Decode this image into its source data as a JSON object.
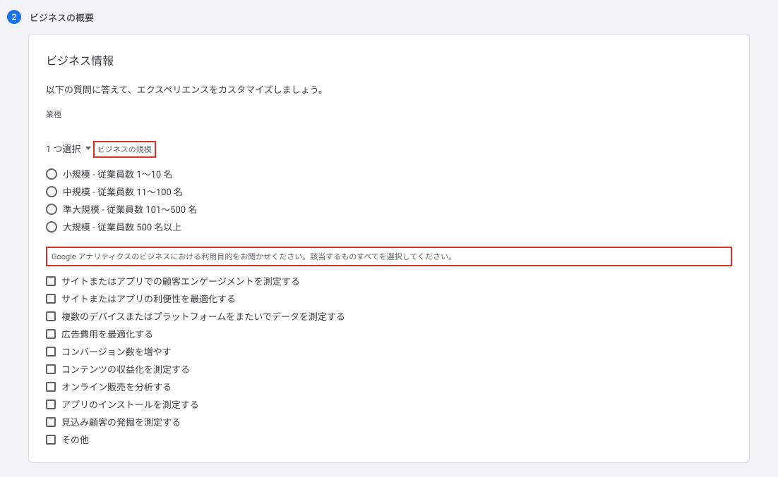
{
  "step": {
    "number": "2",
    "title": "ビジネスの概要"
  },
  "card": {
    "title": "ビジネス情報",
    "description": "以下の質問に答えて、エクスペリエンスをカスタマイズしましょう。",
    "industry": {
      "label": "業種",
      "selected": "1 つ選択"
    },
    "size": {
      "label": "ビジネスの規模",
      "options": [
        "小規模 - 従業員数 1～10 名",
        "中規模 - 従業員数 11～100 名",
        "準大規模 - 従業員数 101～500 名",
        "大規模 - 従業員数 500 名以上"
      ]
    },
    "purpose": {
      "label": "Google アナリティクスのビジネスにおける利用目的をお聞かせください。該当するものすべてを選択してください。",
      "options": [
        "サイトまたはアプリでの顧客エンゲージメントを測定する",
        "サイトまたはアプリの利便性を最適化する",
        "複数のデバイスまたはプラットフォームをまたいでデータを測定する",
        "広告費用を最適化する",
        "コンバージョン数を増やす",
        "コンテンツの収益化を測定する",
        "オンライン販売を分析する",
        "アプリのインストールを測定する",
        "見込み顧客の発掘を測定する",
        "その他"
      ]
    }
  }
}
